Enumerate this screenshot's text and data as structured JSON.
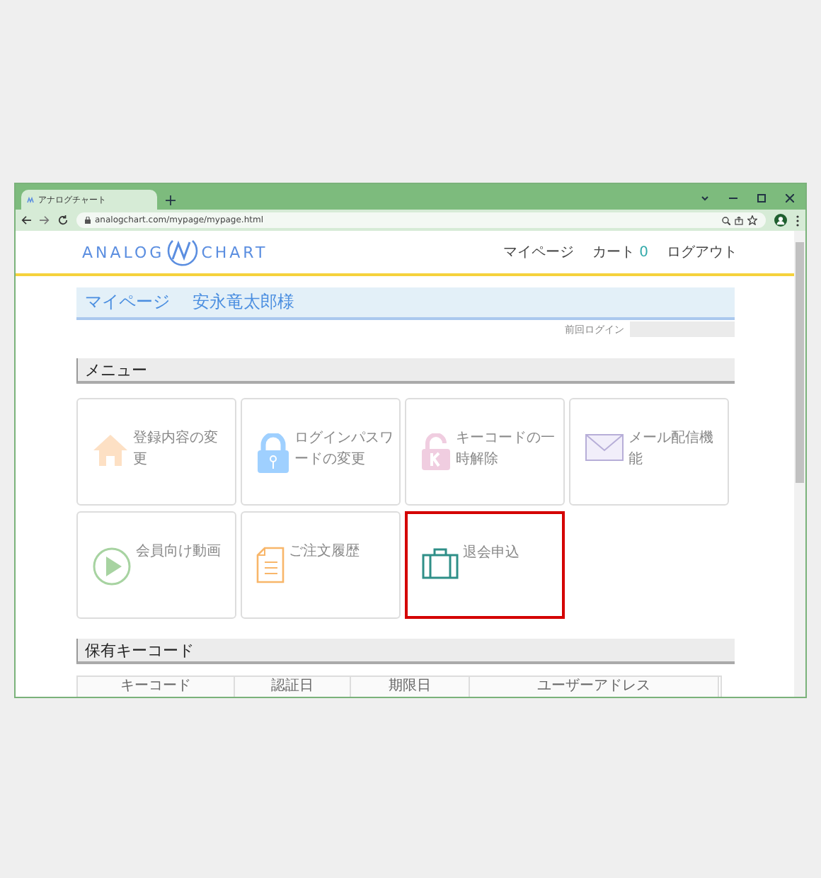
{
  "browser": {
    "tab_title": "アナログチャート",
    "url": "analogchart.com/mypage/mypage.html"
  },
  "header": {
    "logo_left": "ANALOG",
    "logo_right": "CHART",
    "nav": [
      {
        "label": "マイページ"
      },
      {
        "label": "カート",
        "count": "0"
      },
      {
        "label": "ログアウト"
      }
    ]
  },
  "page_title": {
    "title": "マイページ",
    "user": "安永竜太郎様"
  },
  "last_login": {
    "label": "前回ログイン"
  },
  "menu_heading": "メニュー",
  "menu": [
    {
      "kind": "home",
      "label": "登録内容の変更",
      "highlighted": false
    },
    {
      "kind": "lock",
      "label": "ログインパスワードの変更",
      "highlighted": false
    },
    {
      "kind": "key",
      "label": "キーコードの一時解除",
      "highlighted": false
    },
    {
      "kind": "mail",
      "label": "メール配信機能",
      "highlighted": false
    },
    {
      "kind": "play",
      "label": "会員向け動画",
      "highlighted": false
    },
    {
      "kind": "document",
      "label": "ご注文履歴",
      "highlighted": false
    },
    {
      "kind": "suitcase",
      "label": "退会申込",
      "highlighted": true
    }
  ],
  "keycode_heading": "保有キーコード",
  "table": {
    "columns": [
      "キーコード",
      "認証日",
      "期限日",
      "ユーザーアドレス"
    ]
  }
}
